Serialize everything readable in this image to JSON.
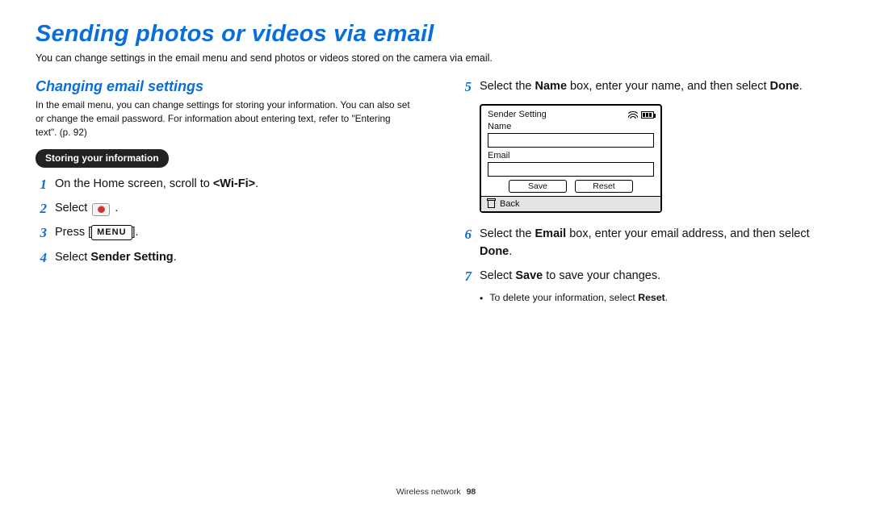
{
  "page_title": "Sending photos or videos via email",
  "intro": "You can change settings in the email menu and send photos or videos stored on the camera via email.",
  "section_title": "Changing email settings",
  "section_intro": "In the email menu, you can change settings for storing your information. You can also set or change the email password. For information about entering text, refer to \"Entering text\". (p. 92)",
  "pill": "Storing your information",
  "left_steps": [
    {
      "n": "1",
      "pre": "On the Home screen, scroll to ",
      "bold": "<Wi-Fi>",
      "post": "."
    },
    {
      "n": "2",
      "pre": "Select ",
      "kind": "email-icon",
      "post": " ."
    },
    {
      "n": "3",
      "pre": "Press [",
      "kind": "menu",
      "menu_text": "MENU",
      "post": "]."
    },
    {
      "n": "4",
      "pre": "Select ",
      "bold": "Sender Setting",
      "post": "."
    }
  ],
  "right_steps_top": {
    "n": "5",
    "segments": [
      "Select the ",
      "Name",
      " box, enter your name, and then select ",
      "Done",
      "."
    ]
  },
  "device": {
    "title": "Sender Setting",
    "name_label": "Name",
    "email_label": "Email",
    "save": "Save",
    "reset": "Reset",
    "back": "Back"
  },
  "right_steps_bottom": [
    {
      "n": "6",
      "segments": [
        "Select the ",
        "Email",
        " box, enter your email address, and then select ",
        "Done",
        "."
      ]
    },
    {
      "n": "7",
      "segments": [
        "Select ",
        "Save",
        " to save your changes."
      ]
    }
  ],
  "note": "To delete your information, select ",
  "note_bold": "Reset",
  "note_post": ".",
  "footer_section": "Wireless network",
  "footer_page": "98"
}
